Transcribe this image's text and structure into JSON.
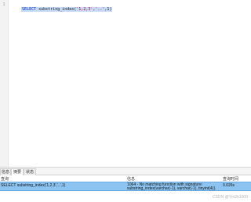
{
  "editor": {
    "line_number": "1",
    "code_keyword": "SELECT",
    "code_function": " substring_index(",
    "code_args": "'1,2,3','..'",
    "code_close": ",1)"
  },
  "tabs": [
    {
      "label": "信息",
      "active": false
    },
    {
      "label": "摘要",
      "active": true
    },
    {
      "label": "状态",
      "active": false
    }
  ],
  "results": {
    "headers": [
      "查询",
      "信息",
      "查询时间"
    ],
    "row": {
      "query": "SELECT substring_index('1,2,3','..',1)",
      "message_line1": "1064 - No matching function with signature:",
      "message_line2": "substring_index(varchar(-1), varchar(-1), tinyint(4)).",
      "time": "0.026s"
    }
  },
  "watermark": "CSDN @Yrn2h1000"
}
